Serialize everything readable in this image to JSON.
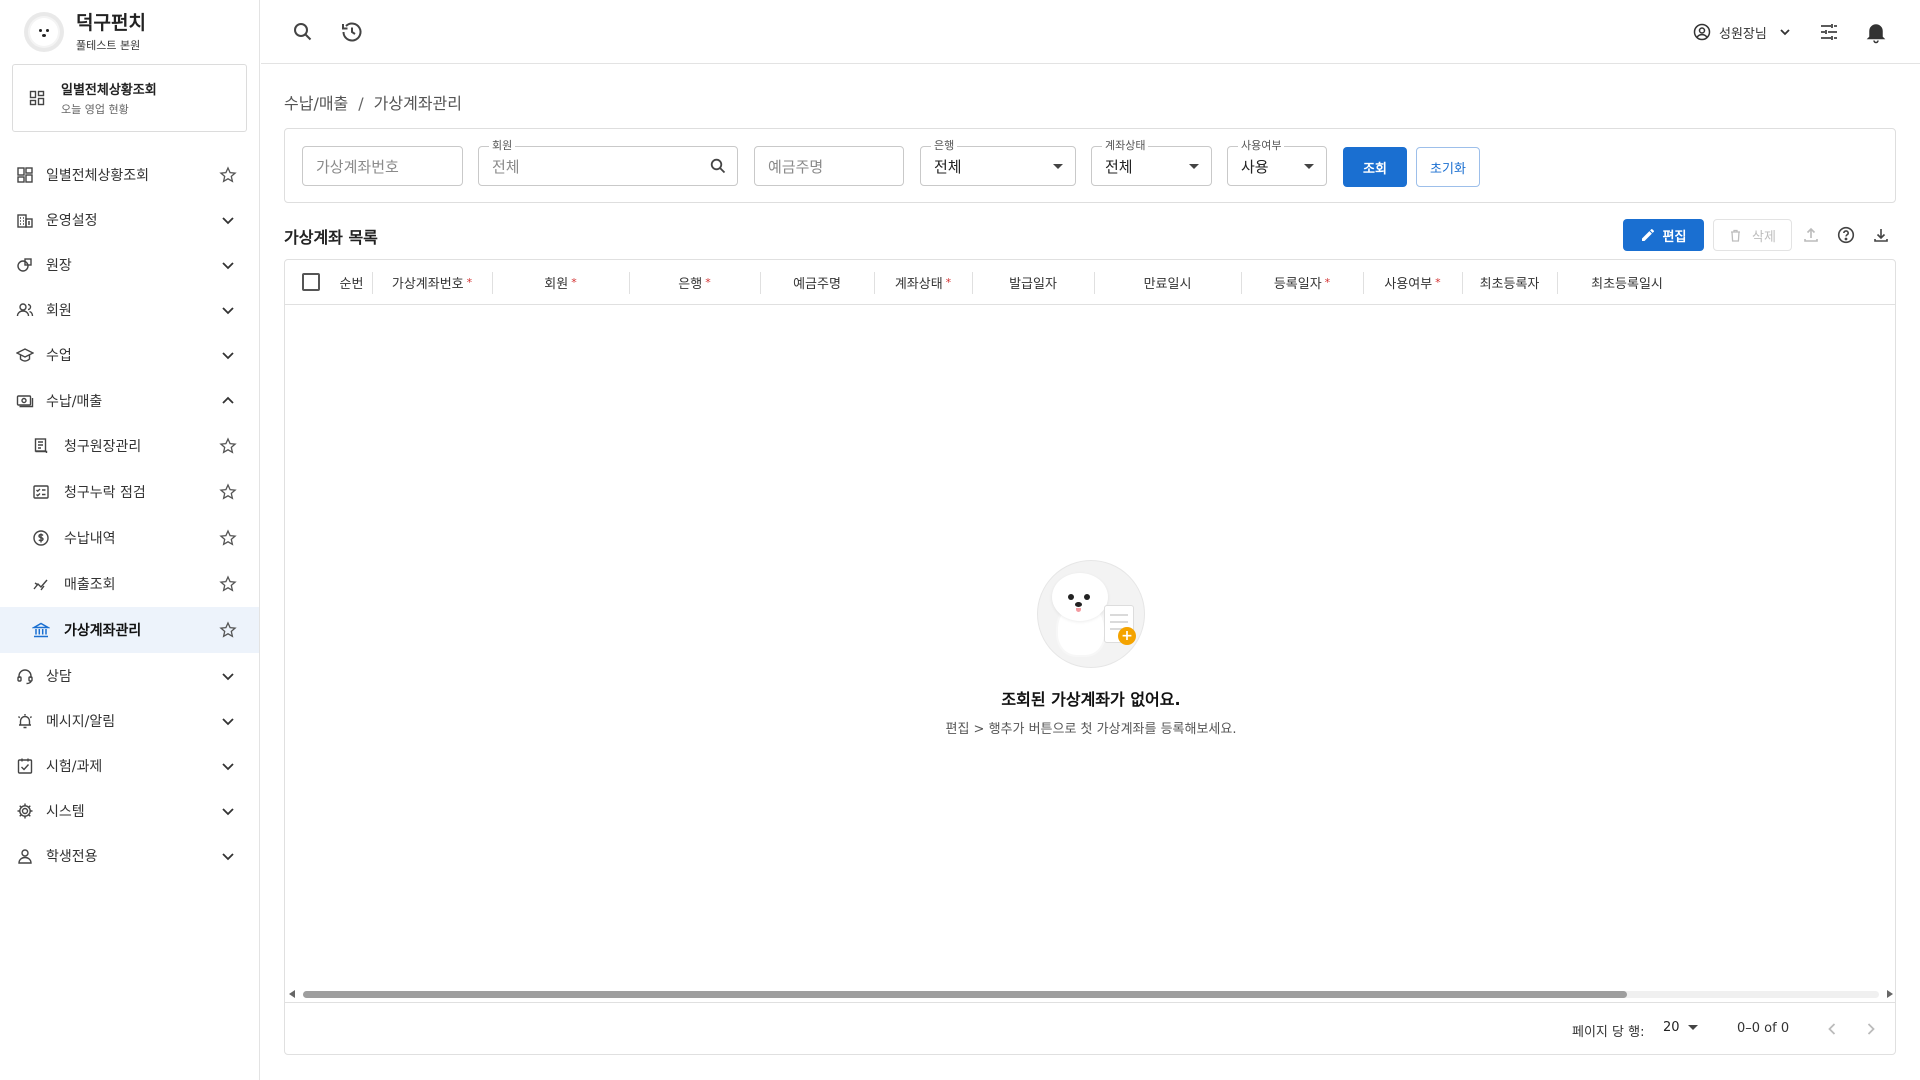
{
  "brand": {
    "name": "덕구펀치",
    "branch": "풀테스트 본원"
  },
  "dashboard_card": {
    "title": "일별전체상황조회",
    "subtitle": "오늘 영업 현황"
  },
  "sidebar": {
    "items": [
      {
        "label": "일별전체상황조회",
        "icon": "dashboard-icon",
        "trail": "star"
      },
      {
        "label": "운영설정",
        "icon": "building-icon",
        "trail": "chevron-down"
      },
      {
        "label": "원장",
        "icon": "shapes-icon",
        "trail": "chevron-down"
      },
      {
        "label": "회원",
        "icon": "people-icon",
        "trail": "chevron-down"
      },
      {
        "label": "수업",
        "icon": "graduation-cap-icon",
        "trail": "chevron-down"
      },
      {
        "label": "수납/매출",
        "icon": "cash-icon",
        "trail": "chevron-up",
        "expanded": true
      },
      {
        "label": "청구원장관리",
        "icon": "ledger-icon",
        "trail": "star",
        "sub": true
      },
      {
        "label": "청구누락 점검",
        "icon": "checklist-icon",
        "trail": "star",
        "sub": true
      },
      {
        "label": "수납내역",
        "icon": "dollar-circle-icon",
        "trail": "star",
        "sub": true
      },
      {
        "label": "매출조회",
        "icon": "trend-icon",
        "trail": "star",
        "sub": true
      },
      {
        "label": "가상계좌관리",
        "icon": "bank-icon",
        "trail": "star",
        "sub": true,
        "active": true
      },
      {
        "label": "상담",
        "icon": "headset-icon",
        "trail": "chevron-down"
      },
      {
        "label": "메시지/알림",
        "icon": "alarm-icon",
        "trail": "chevron-down"
      },
      {
        "label": "시험/과제",
        "icon": "task-icon",
        "trail": "chevron-down"
      },
      {
        "label": "시스템",
        "icon": "gear-icon",
        "trail": "chevron-down"
      },
      {
        "label": "학생전용",
        "icon": "person-icon",
        "trail": "chevron-down"
      }
    ]
  },
  "topbar": {
    "user_name": "성원장님"
  },
  "breadcrumb": {
    "parent": "수납/매출",
    "separator": "/",
    "current": "가상계좌관리"
  },
  "filters": {
    "account_number": {
      "placeholder": "가상계좌번호"
    },
    "member": {
      "legend": "회원",
      "placeholder": "전체"
    },
    "depositor": {
      "placeholder": "예금주명"
    },
    "bank": {
      "legend": "은행",
      "value": "전체"
    },
    "account_status": {
      "legend": "계좌상태",
      "value": "전체"
    },
    "usage": {
      "legend": "사용여부",
      "value": "사용"
    },
    "search_label": "조회",
    "reset_label": "초기화"
  },
  "list": {
    "title": "가상계좌 목록",
    "edit_label": "편집",
    "delete_label": "삭제",
    "columns": [
      {
        "label": "순번",
        "required": false
      },
      {
        "label": "가상계좌번호",
        "required": true
      },
      {
        "label": "회원",
        "required": true
      },
      {
        "label": "은행",
        "required": true
      },
      {
        "label": "예금주명",
        "required": false
      },
      {
        "label": "계좌상태",
        "required": true
      },
      {
        "label": "발급일자",
        "required": false
      },
      {
        "label": "만료일시",
        "required": false
      },
      {
        "label": "등록일자",
        "required": true
      },
      {
        "label": "사용여부",
        "required": true
      },
      {
        "label": "최초등록자",
        "required": false
      },
      {
        "label": "최초등록일시",
        "required": false
      }
    ],
    "required_mark": "*",
    "empty_title": "조회된 가상계좌가 없어요.",
    "empty_subtitle": "편집 > 행추가 버튼으로 첫 가상계좌를 등록해보세요.",
    "empty_badge": "+",
    "rows_per_page_label": "페이지 당 행:",
    "rows_per_page_value": "20",
    "range_text": "0–0 of 0"
  },
  "colors": {
    "accent": "#1a6fd1",
    "required": "#d32f2f",
    "active_bg": "#edf3fb",
    "badge": "#f4a300"
  }
}
